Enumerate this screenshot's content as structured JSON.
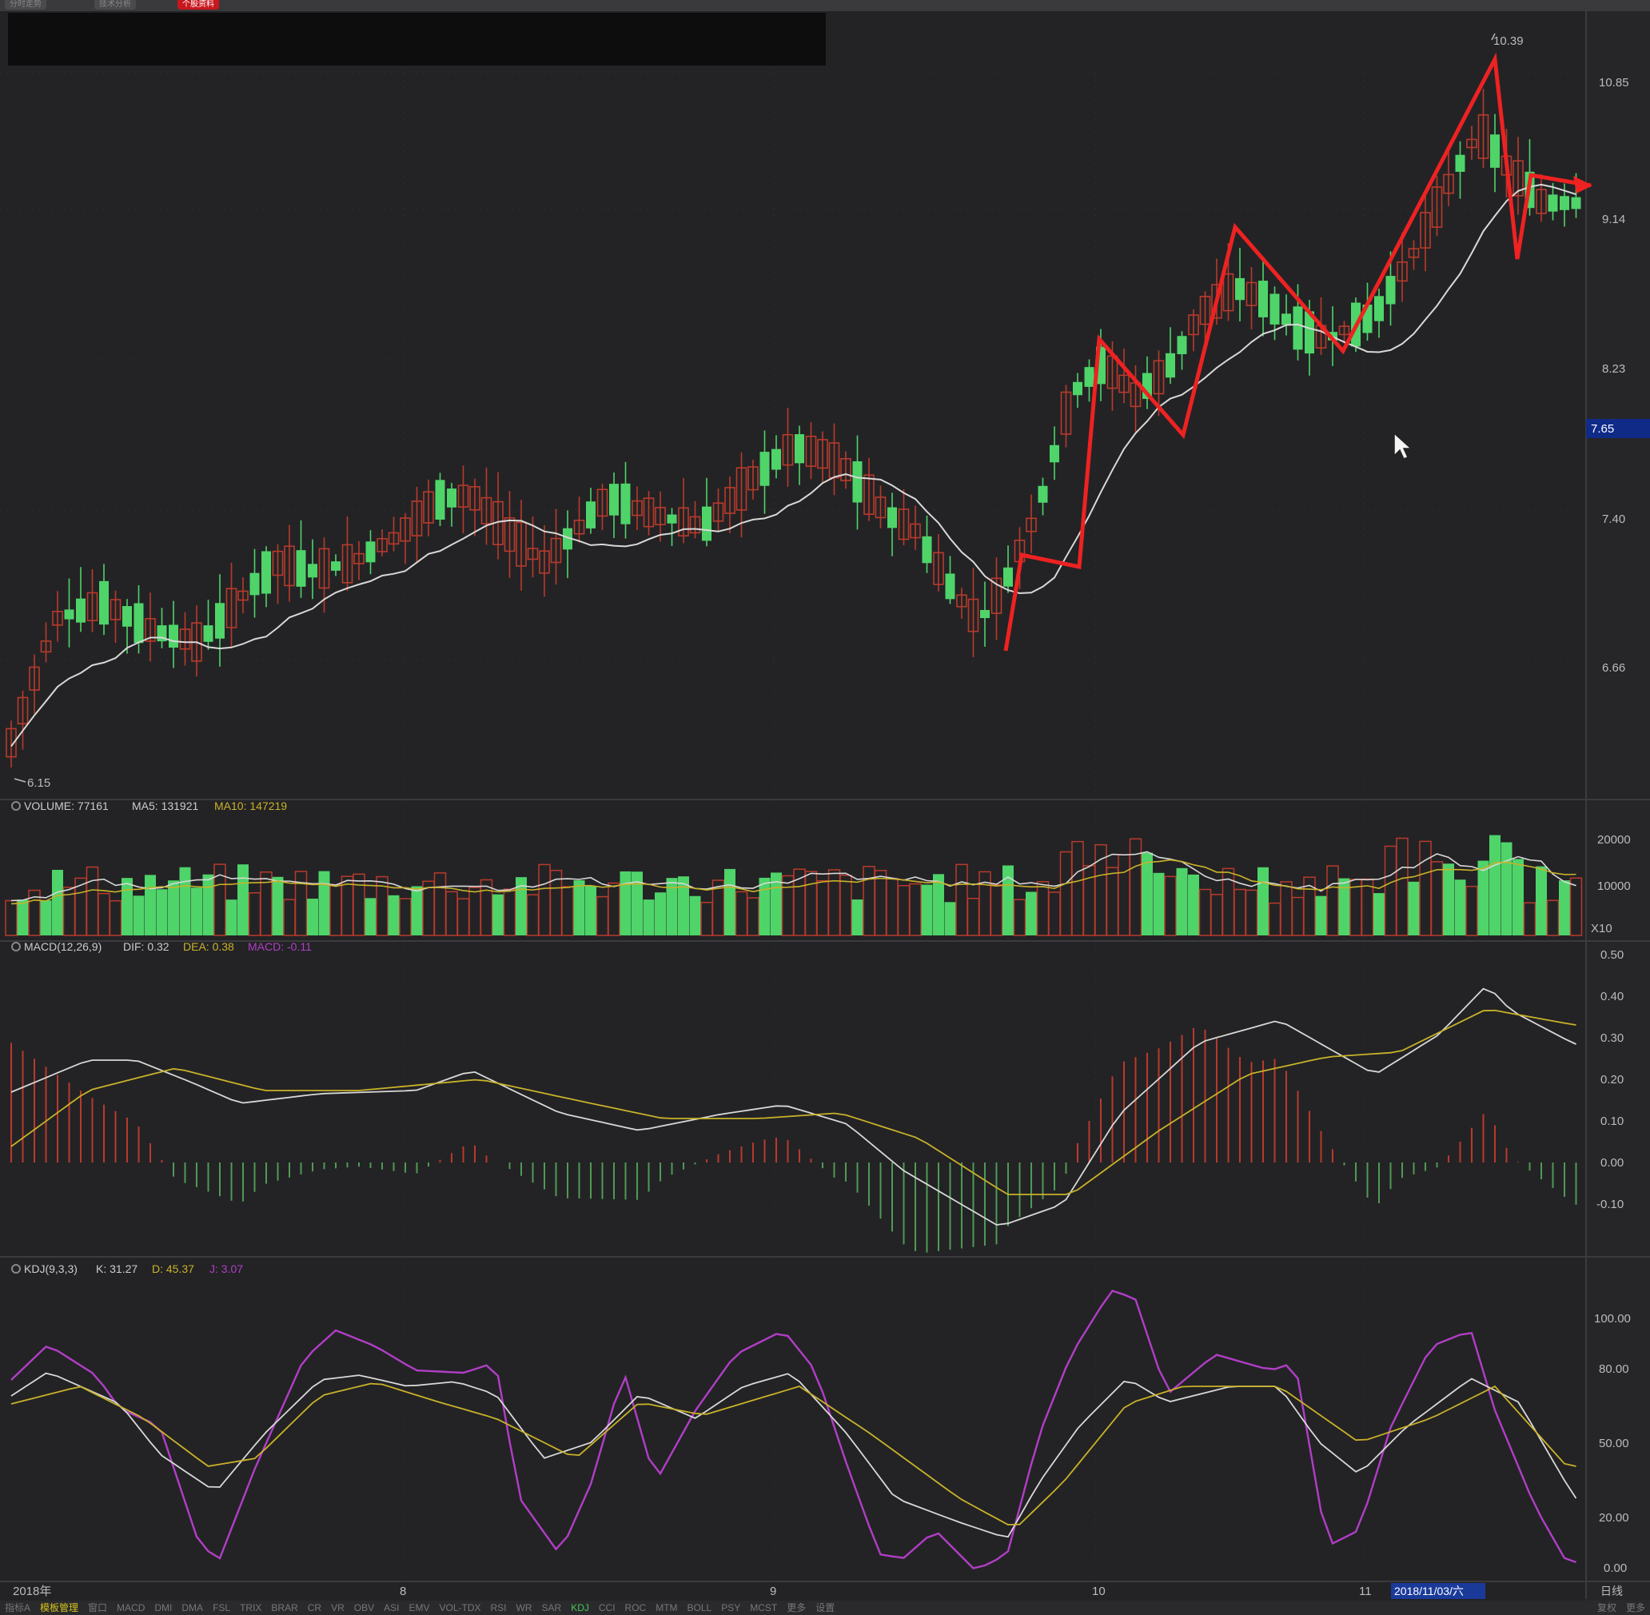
{
  "top_tabs": [
    "分时走势",
    "技术分析",
    "个股资料"
  ],
  "price_panel": {
    "price_ticks": [
      "10.85",
      "9.14",
      "8.23",
      "7.40",
      "6.66"
    ],
    "current_price_tag": "7.65",
    "high_label": "10.39",
    "low_label": "6.15"
  },
  "volume_panel": {
    "indicator": "VOLUME: 77161",
    "ma5": "MA5: 131921",
    "ma10": "MA10: 147219",
    "ticks": [
      "20000",
      "10000"
    ],
    "unit": "X10"
  },
  "macd_panel": {
    "indicator": "MACD(12,26,9)",
    "dif": "DIF: 0.32",
    "dea": "DEA: 0.38",
    "macd": "MACD: -0.11",
    "ticks": [
      "0.50",
      "0.40",
      "0.30",
      "0.20",
      "0.10",
      "0.00",
      "-0.10"
    ]
  },
  "kdj_panel": {
    "indicator": "KDJ(9,3,3)",
    "k": "K: 31.27",
    "d": "D: 45.37",
    "j": "J: 3.07",
    "ticks": [
      "100.00",
      "80.00",
      "50.00",
      "20.00",
      "0.00"
    ]
  },
  "x_axis": {
    "labels": [
      "2018年",
      "8",
      "9",
      "10",
      "11"
    ],
    "date_highlight": "2018/11/03/六",
    "period": "日线"
  },
  "bottom_tabs": [
    "指标A",
    "模板管理",
    "窗口",
    "MACD",
    "DMI",
    "DMA",
    "FSL",
    "TRIX",
    "BRAR",
    "CR",
    "VR",
    "OBV",
    "ASI",
    "EMV",
    "VOL-TDX",
    "RSI",
    "WR",
    "SAR",
    "KDJ",
    "CCI",
    "ROC",
    "MTM",
    "BOLL",
    "PSY",
    "MCST",
    "更多",
    "设置"
  ],
  "bottom_right": [
    "复权",
    "更多"
  ],
  "colors": {
    "up": "#b93a2c",
    "down": "#4fd46a",
    "ma": "#d8d8d8",
    "yellow": "#c9b229",
    "purple": "#b13ec6",
    "annotation": "#ee2222",
    "background": "#232325"
  }
}
